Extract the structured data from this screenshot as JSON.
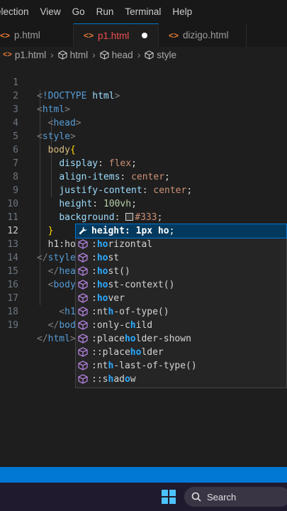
{
  "menu": [
    "election",
    "View",
    "Go",
    "Run",
    "Terminal",
    "Help"
  ],
  "tabs": [
    {
      "icon": "<>",
      "label": "p.html"
    },
    {
      "icon": "<>",
      "label": "p1.html",
      "modified": true
    },
    {
      "icon": "<>",
      "label": "dizigo.html"
    }
  ],
  "breadcrumb": {
    "file": "p1.html",
    "items": [
      "html",
      "head",
      "style"
    ]
  },
  "editor": {
    "line_numbers": [
      "1",
      "2",
      "3",
      "4",
      "5",
      "6",
      "7",
      "8",
      "9",
      "10",
      "11",
      "12",
      "13",
      "14",
      "15",
      "16",
      "17",
      "18",
      "19"
    ],
    "lines": {
      "l1_doctype": "!DOCTYPE",
      "l1_html": "html",
      "l2": "html",
      "l3": "head",
      "l4": "style",
      "l5_sel": "body",
      "l6_prop": "display",
      "l6_val": "flex",
      "l7_prop": "align-items",
      "l7_val": "center",
      "l8_prop": "justify-content",
      "l8_val": "center",
      "l9_prop": "height",
      "l9_val": "100vh",
      "l10_prop": "background",
      "l10_val": "#333",
      "l12_text": "h1:ho",
      "l13": "style",
      "l14": "hea",
      "l15": "body",
      "l17": "h1",
      "l18": "bod",
      "l19": "html"
    }
  },
  "suggestions": [
    {
      "pre": "",
      "m": "height: 1px ho",
      "post": ";",
      "active": true
    },
    {
      "pre": ":",
      "m": "ho",
      "post": "rizontal"
    },
    {
      "pre": ":",
      "m": "ho",
      "post": "st"
    },
    {
      "pre": ":",
      "m": "ho",
      "post": "st()"
    },
    {
      "pre": ":",
      "m": "ho",
      "post": "st-context()"
    },
    {
      "pre": ":",
      "m": "ho",
      "post": "ver"
    },
    {
      "pre": ":nt",
      "m": "h",
      "post": "-of-type()"
    },
    {
      "pre": ":only-c",
      "m": "h",
      "post": "ild"
    },
    {
      "pre": ":place",
      "m": "ho",
      "post": "lder-shown"
    },
    {
      "pre": "::place",
      "m": "ho",
      "post": "lder"
    },
    {
      "pre": ":nt",
      "m": "h",
      "post": "-last-of-type()"
    },
    {
      "pre": "::s",
      "m": "h",
      "post": "ad",
      "m2": "o",
      "post2": "w"
    }
  ],
  "taskbar": {
    "search_label": "Search"
  },
  "colors": {
    "accent": "#0078d4",
    "editor_bg": "#1e1e1e",
    "suggest_highlight": "#2aaaff"
  }
}
